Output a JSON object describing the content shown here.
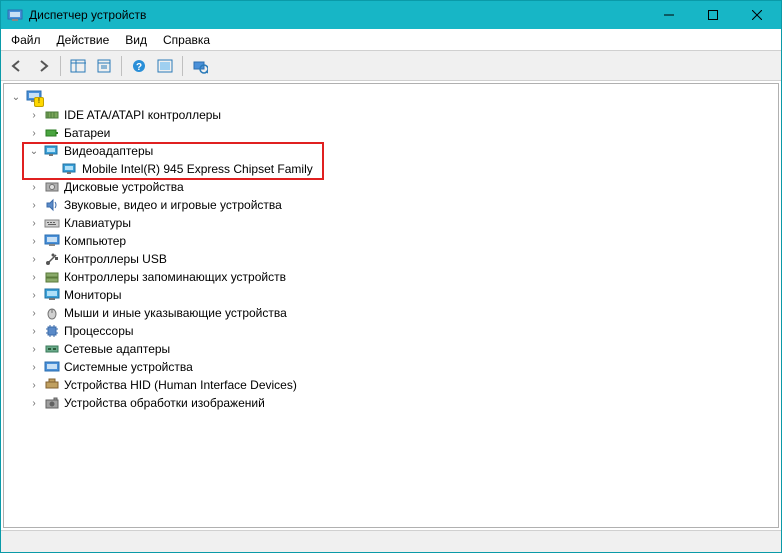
{
  "window": {
    "title": "Диспетчер устройств"
  },
  "menu": {
    "file": "Файл",
    "action": "Действие",
    "view": "Вид",
    "help": "Справка"
  },
  "tree": {
    "root": "",
    "items": [
      {
        "label": "IDE ATA/ATAPI контроллеры"
      },
      {
        "label": "Батареи"
      },
      {
        "label": "Видеоадаптеры"
      },
      {
        "label": "Mobile Intel(R) 945 Express Chipset Family"
      },
      {
        "label": "Дисковые устройства"
      },
      {
        "label": "Звуковые, видео и игровые устройства"
      },
      {
        "label": "Клавиатуры"
      },
      {
        "label": "Компьютер"
      },
      {
        "label": "Контроллеры USB"
      },
      {
        "label": "Контроллеры запоминающих устройств"
      },
      {
        "label": "Мониторы"
      },
      {
        "label": "Мыши и иные указывающие устройства"
      },
      {
        "label": "Процессоры"
      },
      {
        "label": "Сетевые адаптеры"
      },
      {
        "label": "Системные устройства"
      },
      {
        "label": "Устройства HID (Human Interface Devices)"
      },
      {
        "label": "Устройства обработки изображений"
      }
    ]
  }
}
